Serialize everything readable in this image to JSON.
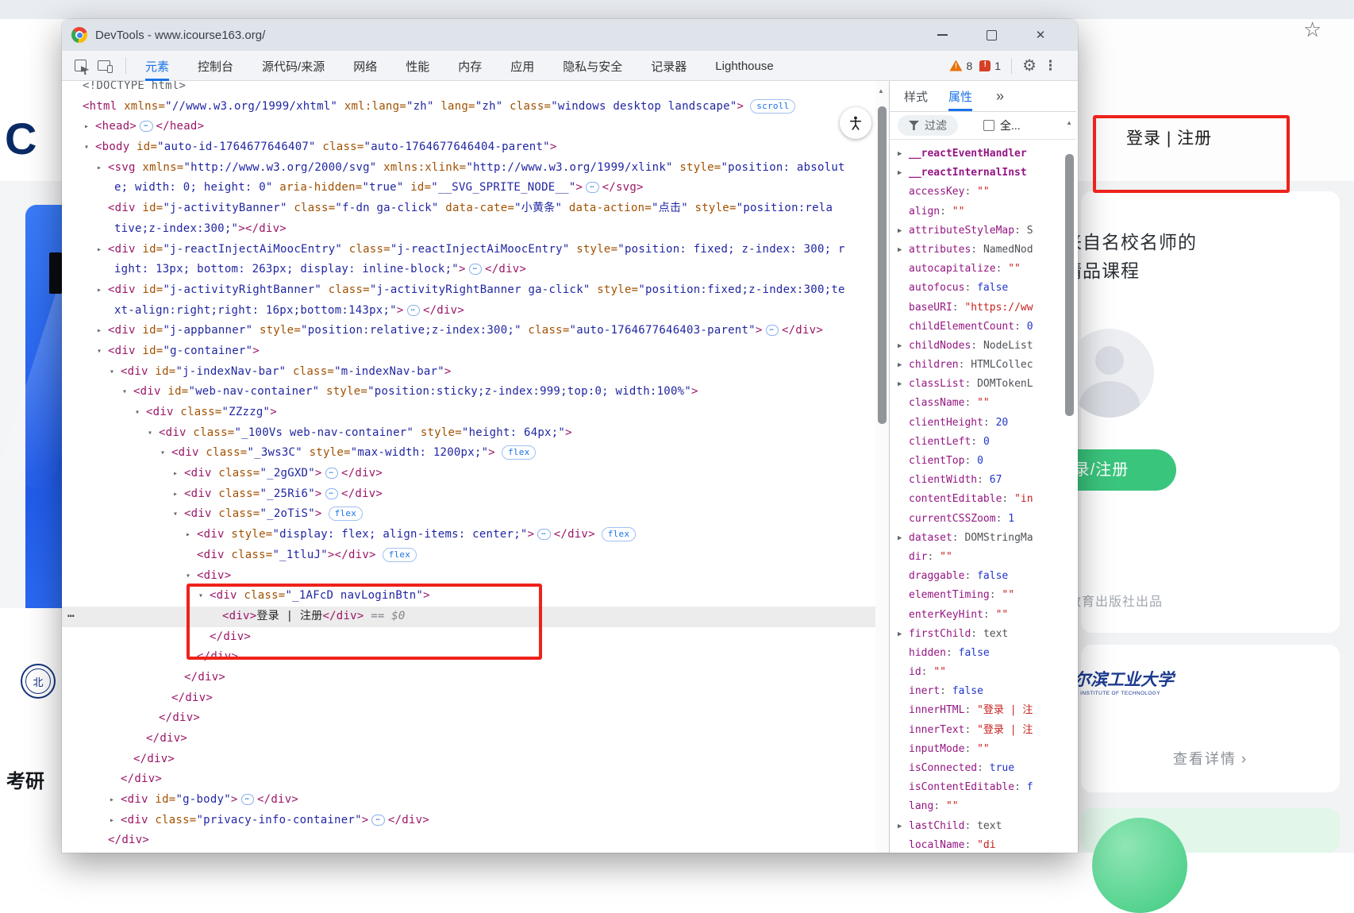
{
  "colors": {
    "annotation_red": "#ee221b",
    "devtools_accent_blue": "#1a73e8",
    "tag_color": "#9a1566",
    "attr_color": "#a15000",
    "value_color": "#2026a2",
    "prop_name_color": "#941682",
    "string_value_color": "#c5221f",
    "number_value_color": "#2036c9",
    "warning_orange": "#e8710a",
    "error_red": "#d93025",
    "green_button": "#3ac57d"
  },
  "page": {
    "logo_fragment": "C",
    "kaoyan": "考研",
    "star": "☆",
    "login_register": "登录 | 注册",
    "card_title_line1": "来自名校名师的",
    "card_title_line2": "精品课程",
    "green_button_label": "登录/注册",
    "publisher": "高等教育出版社出品",
    "university": "哈尔滨工业大学",
    "university_en": "HARBIN INSTITUTE OF TECHNOLOGY",
    "view_details": "查看详情",
    "chevron": "›",
    "seal_char": "北"
  },
  "devtools": {
    "title": "DevTools - www.icourse163.org/",
    "window_controls": {
      "minimize": "—",
      "maximize": "□",
      "close": "✕"
    },
    "toolbar": {
      "tabs": [
        {
          "label": "元素",
          "selected": true
        },
        {
          "label": "控制台"
        },
        {
          "label": "源代码/来源"
        },
        {
          "label": "网络"
        },
        {
          "label": "性能"
        },
        {
          "label": "内存"
        },
        {
          "label": "应用"
        },
        {
          "label": "隐私与安全"
        },
        {
          "label": "记录器"
        },
        {
          "label": "Lighthouse"
        }
      ],
      "warning_count": "8",
      "error_count": "1"
    },
    "panel": {
      "tabs": [
        {
          "label": "样式"
        },
        {
          "label": "属性",
          "selected": true
        }
      ],
      "more": "»",
      "filter_label": "过滤",
      "checkbox_label": "全..."
    },
    "code_lines": [
      {
        "i": 0,
        "seg": [
          [
            "y",
            "<!DOCTYPE html>"
          ]
        ]
      },
      {
        "i": 0,
        "seg": [
          [
            "p",
            "<html"
          ],
          [
            "a",
            " xmlns="
          ],
          [
            "v",
            "\"//www.w3.org/1999/xhtml\""
          ],
          [
            "a",
            " xml:lang="
          ],
          [
            "v",
            "\"zh\""
          ],
          [
            "a",
            " lang="
          ],
          [
            "v",
            "\"zh\""
          ],
          [
            "a",
            " class="
          ],
          [
            "v",
            "\"windows desktop landscape\""
          ],
          [
            "p",
            ">"
          ],
          [
            "b",
            "scroll"
          ]
        ]
      },
      {
        "i": 1,
        "a": "r",
        "seg": [
          [
            "p",
            "<head>"
          ],
          [
            "d",
            ""
          ],
          [
            "p",
            "</head>"
          ]
        ]
      },
      {
        "i": 1,
        "a": "d",
        "seg": [
          [
            "p",
            "<body"
          ],
          [
            "a",
            " id="
          ],
          [
            "v",
            "\"auto-id-1764677646407\""
          ],
          [
            "a",
            " class="
          ],
          [
            "v",
            "\"auto-1764677646404-parent\""
          ],
          [
            "p",
            ">"
          ]
        ]
      },
      {
        "i": 2,
        "a": "r",
        "seg": [
          [
            "p",
            "<svg"
          ],
          [
            "a",
            " xmlns="
          ],
          [
            "v",
            "\"http://www.w3.org/2000/svg\""
          ],
          [
            "a",
            " xmlns:xlink="
          ],
          [
            "v",
            "\"http://www.w3.org/1999/xlink\""
          ],
          [
            "a",
            " style="
          ],
          [
            "v",
            "\"position: absolut"
          ]
        ]
      },
      {
        "i": 2,
        "cont": 1,
        "seg": [
          [
            "v",
            "e; width: 0; height: 0\""
          ],
          [
            "a",
            " aria-hidden="
          ],
          [
            "v",
            "\"true\""
          ],
          [
            "a",
            " id="
          ],
          [
            "v",
            "\"__SVG_SPRITE_NODE__\""
          ],
          [
            "p",
            ">"
          ],
          [
            "d",
            ""
          ],
          [
            "p",
            "</svg>"
          ]
        ]
      },
      {
        "i": 2,
        "seg": [
          [
            "p",
            "<div"
          ],
          [
            "a",
            " id="
          ],
          [
            "v",
            "\"j-activityBanner\""
          ],
          [
            "a",
            " class="
          ],
          [
            "v",
            "\"f-dn ga-click\""
          ],
          [
            "a",
            " data-cate="
          ],
          [
            "v",
            "\"小黄条\""
          ],
          [
            "a",
            " data-action="
          ],
          [
            "v",
            "\"点击\""
          ],
          [
            "a",
            " style="
          ],
          [
            "v",
            "\"position:rela"
          ]
        ]
      },
      {
        "i": 2,
        "cont": 1,
        "seg": [
          [
            "v",
            "tive;z-index:300;\""
          ],
          [
            "p",
            "></div>"
          ]
        ]
      },
      {
        "i": 2,
        "a": "r",
        "seg": [
          [
            "p",
            "<div"
          ],
          [
            "a",
            " id="
          ],
          [
            "v",
            "\"j-reactInjectAiMoocEntry\""
          ],
          [
            "a",
            " class="
          ],
          [
            "v",
            "\"j-reactInjectAiMoocEntry\""
          ],
          [
            "a",
            " style="
          ],
          [
            "v",
            "\"position: fixed; z-index: 300; r"
          ]
        ]
      },
      {
        "i": 2,
        "cont": 1,
        "seg": [
          [
            "v",
            "ight: 13px; bottom: 263px; display: inline-block;\""
          ],
          [
            "p",
            ">"
          ],
          [
            "d",
            ""
          ],
          [
            "p",
            "</div>"
          ]
        ]
      },
      {
        "i": 2,
        "a": "r",
        "seg": [
          [
            "p",
            "<div"
          ],
          [
            "a",
            " id="
          ],
          [
            "v",
            "\"j-activityRightBanner\""
          ],
          [
            "a",
            " class="
          ],
          [
            "v",
            "\"j-activityRightBanner ga-click\""
          ],
          [
            "a",
            " style="
          ],
          [
            "v",
            "\"position:fixed;z-index:300;te"
          ]
        ]
      },
      {
        "i": 2,
        "cont": 1,
        "seg": [
          [
            "v",
            "xt-align:right;right: 16px;bottom:143px;\""
          ],
          [
            "p",
            ">"
          ],
          [
            "d",
            ""
          ],
          [
            "p",
            "</div>"
          ]
        ]
      },
      {
        "i": 2,
        "a": "r",
        "seg": [
          [
            "p",
            "<div"
          ],
          [
            "a",
            " id="
          ],
          [
            "v",
            "\"j-appbanner\""
          ],
          [
            "a",
            " style="
          ],
          [
            "v",
            "\"position:relative;z-index:300;\""
          ],
          [
            "a",
            " class="
          ],
          [
            "v",
            "\"auto-1764677646403-parent\""
          ],
          [
            "p",
            ">"
          ],
          [
            "d",
            ""
          ],
          [
            "p",
            "</div>"
          ]
        ]
      },
      {
        "i": 2,
        "a": "d",
        "seg": [
          [
            "p",
            "<div"
          ],
          [
            "a",
            " id="
          ],
          [
            "v",
            "\"g-container\""
          ],
          [
            "p",
            ">"
          ]
        ]
      },
      {
        "i": 3,
        "a": "d",
        "seg": [
          [
            "p",
            "<div"
          ],
          [
            "a",
            " id="
          ],
          [
            "v",
            "\"j-indexNav-bar\""
          ],
          [
            "a",
            " class="
          ],
          [
            "v",
            "\"m-indexNav-bar\""
          ],
          [
            "p",
            ">"
          ]
        ]
      },
      {
        "i": 4,
        "a": "d",
        "seg": [
          [
            "p",
            "<div"
          ],
          [
            "a",
            " id="
          ],
          [
            "v",
            "\"web-nav-container\""
          ],
          [
            "a",
            " style="
          ],
          [
            "v",
            "\"position:sticky;z-index:999;top:0; width:100%\""
          ],
          [
            "p",
            ">"
          ]
        ]
      },
      {
        "i": 5,
        "a": "d",
        "seg": [
          [
            "p",
            "<div"
          ],
          [
            "a",
            " class="
          ],
          [
            "v",
            "\"ZZzzg\""
          ],
          [
            "p",
            ">"
          ]
        ]
      },
      {
        "i": 6,
        "a": "d",
        "seg": [
          [
            "p",
            "<div"
          ],
          [
            "a",
            " class="
          ],
          [
            "v",
            "\"_100Vs web-nav-container\""
          ],
          [
            "a",
            " style="
          ],
          [
            "v",
            "\"height: 64px;\""
          ],
          [
            "p",
            ">"
          ]
        ]
      },
      {
        "i": 7,
        "a": "d",
        "seg": [
          [
            "p",
            "<div"
          ],
          [
            "a",
            " class="
          ],
          [
            "v",
            "\"_3ws3C\""
          ],
          [
            "a",
            " style="
          ],
          [
            "v",
            "\"max-width: 1200px;\""
          ],
          [
            "p",
            ">"
          ],
          [
            "b",
            "flex"
          ]
        ]
      },
      {
        "i": 8,
        "a": "r",
        "seg": [
          [
            "p",
            "<div"
          ],
          [
            "a",
            " class="
          ],
          [
            "v",
            "\"_2gGXD\""
          ],
          [
            "p",
            ">"
          ],
          [
            "d",
            ""
          ],
          [
            "p",
            "</div>"
          ]
        ]
      },
      {
        "i": 8,
        "a": "r",
        "seg": [
          [
            "p",
            "<div"
          ],
          [
            "a",
            " class="
          ],
          [
            "v",
            "\"_25Ri6\""
          ],
          [
            "p",
            ">"
          ],
          [
            "d",
            ""
          ],
          [
            "p",
            "</div>"
          ]
        ]
      },
      {
        "i": 8,
        "a": "d",
        "seg": [
          [
            "p",
            "<div"
          ],
          [
            "a",
            " class="
          ],
          [
            "v",
            "\"_2oTiS\""
          ],
          [
            "p",
            ">"
          ],
          [
            "b",
            "flex"
          ]
        ]
      },
      {
        "i": 9,
        "a": "r",
        "seg": [
          [
            "p",
            "<div"
          ],
          [
            "a",
            " style="
          ],
          [
            "v",
            "\"display: flex; align-items: center;\""
          ],
          [
            "p",
            ">"
          ],
          [
            "d",
            ""
          ],
          [
            "p",
            "</div>"
          ],
          [
            "b",
            "flex"
          ]
        ]
      },
      {
        "i": 9,
        "seg": [
          [
            "p",
            "<div"
          ],
          [
            "a",
            " class="
          ],
          [
            "v",
            "\"_1tluJ\""
          ],
          [
            "p",
            "></div>"
          ],
          [
            "b",
            "flex"
          ]
        ]
      },
      {
        "i": 9,
        "a": "d",
        "seg": [
          [
            "p",
            "<div>"
          ]
        ]
      },
      {
        "i": 10,
        "a": "d",
        "seg": [
          [
            "p",
            "<div"
          ],
          [
            "a",
            " class="
          ],
          [
            "v",
            "\"_1AFcD navLoginBtn\""
          ],
          [
            "p",
            ">"
          ]
        ]
      },
      {
        "i": 11,
        "hl": 1,
        "seg": [
          [
            "p",
            "<div>"
          ],
          [
            "t",
            "登录 | 注册"
          ],
          [
            "p",
            "</div>"
          ],
          [
            "g",
            " == $0"
          ]
        ]
      },
      {
        "i": 10,
        "seg": [
          [
            "p",
            "</div>"
          ]
        ]
      },
      {
        "i": 9,
        "seg": [
          [
            "p",
            "</div>"
          ]
        ]
      },
      {
        "i": 8,
        "seg": [
          [
            "p",
            "</div>"
          ]
        ]
      },
      {
        "i": 7,
        "seg": [
          [
            "p",
            "</div>"
          ]
        ]
      },
      {
        "i": 6,
        "seg": [
          [
            "p",
            "</div>"
          ]
        ]
      },
      {
        "i": 5,
        "seg": [
          [
            "p",
            "</div>"
          ]
        ]
      },
      {
        "i": 4,
        "seg": [
          [
            "p",
            "</div>"
          ]
        ]
      },
      {
        "i": 3,
        "seg": [
          [
            "p",
            "</div>"
          ]
        ]
      },
      {
        "i": 3,
        "a": "r",
        "seg": [
          [
            "p",
            "<div"
          ],
          [
            "a",
            " id="
          ],
          [
            "v",
            "\"g-body\""
          ],
          [
            "p",
            ">"
          ],
          [
            "d",
            ""
          ],
          [
            "p",
            "</div>"
          ]
        ]
      },
      {
        "i": 3,
        "a": "r",
        "seg": [
          [
            "p",
            "<div"
          ],
          [
            "a",
            " class="
          ],
          [
            "v",
            "\"privacy-info-container\""
          ],
          [
            "p",
            ">"
          ],
          [
            "d",
            ""
          ],
          [
            "p",
            "</div>"
          ]
        ]
      },
      {
        "i": 2,
        "seg": [
          [
            "p",
            "</div>"
          ]
        ]
      }
    ],
    "properties": [
      {
        "e": 1,
        "b": 1,
        "n": "__reactEventHandler"
      },
      {
        "e": 1,
        "b": 1,
        "n": "__reactInternalInst"
      },
      {
        "n": "accessKey",
        "v": "\"\"",
        "t": "s"
      },
      {
        "n": "align",
        "v": "\"\"",
        "t": "s"
      },
      {
        "e": 1,
        "n": "attributeStyleMap",
        "v": "S",
        "t": "o"
      },
      {
        "e": 1,
        "n": "attributes",
        "v": "NamedNod",
        "t": "o"
      },
      {
        "n": "autocapitalize",
        "v": "\"\"",
        "t": "s"
      },
      {
        "n": "autofocus",
        "v": "false",
        "t": "k"
      },
      {
        "n": "baseURI",
        "v": "\"https://ww",
        "t": "s"
      },
      {
        "n": "childElementCount",
        "v": "0",
        "t": "k"
      },
      {
        "e": 1,
        "n": "childNodes",
        "v": "NodeList",
        "t": "o"
      },
      {
        "e": 1,
        "n": "children",
        "v": "HTMLCollec",
        "t": "o"
      },
      {
        "e": 1,
        "n": "classList",
        "v": "DOMTokenL",
        "t": "o"
      },
      {
        "n": "className",
        "v": "\"\"",
        "t": "s"
      },
      {
        "n": "clientHeight",
        "v": "20",
        "t": "k"
      },
      {
        "n": "clientLeft",
        "v": "0",
        "t": "k"
      },
      {
        "n": "clientTop",
        "v": "0",
        "t": "k"
      },
      {
        "n": "clientWidth",
        "v": "67",
        "t": "k"
      },
      {
        "n": "contentEditable",
        "v": "\"in",
        "t": "s"
      },
      {
        "n": "currentCSSZoom",
        "v": "1",
        "t": "k"
      },
      {
        "e": 1,
        "n": "dataset",
        "v": "DOMStringMa",
        "t": "o"
      },
      {
        "n": "dir",
        "v": "\"\"",
        "t": "s"
      },
      {
        "n": "draggable",
        "v": "false",
        "t": "k"
      },
      {
        "n": "elementTiming",
        "v": "\"\"",
        "t": "s"
      },
      {
        "n": "enterKeyHint",
        "v": "\"\"",
        "t": "s"
      },
      {
        "e": 1,
        "n": "firstChild",
        "v": "text",
        "t": "o"
      },
      {
        "n": "hidden",
        "v": "false",
        "t": "k"
      },
      {
        "n": "id",
        "v": "\"\"",
        "t": "s"
      },
      {
        "n": "inert",
        "v": "false",
        "t": "k"
      },
      {
        "n": "innerHTML",
        "v": "\"登录 | 注",
        "t": "s"
      },
      {
        "n": "innerText",
        "v": "\"登录 | 注",
        "t": "s"
      },
      {
        "n": "inputMode",
        "v": "\"\"",
        "t": "s"
      },
      {
        "n": "isConnected",
        "v": "true",
        "t": "k"
      },
      {
        "n": "isContentEditable",
        "v": "f",
        "t": "k"
      },
      {
        "n": "lang",
        "v": "\"\"",
        "t": "s"
      },
      {
        "e": 1,
        "n": "lastChild",
        "v": "text",
        "t": "o"
      },
      {
        "n": "localName",
        "v": "\"di",
        "t": "s"
      }
    ]
  }
}
